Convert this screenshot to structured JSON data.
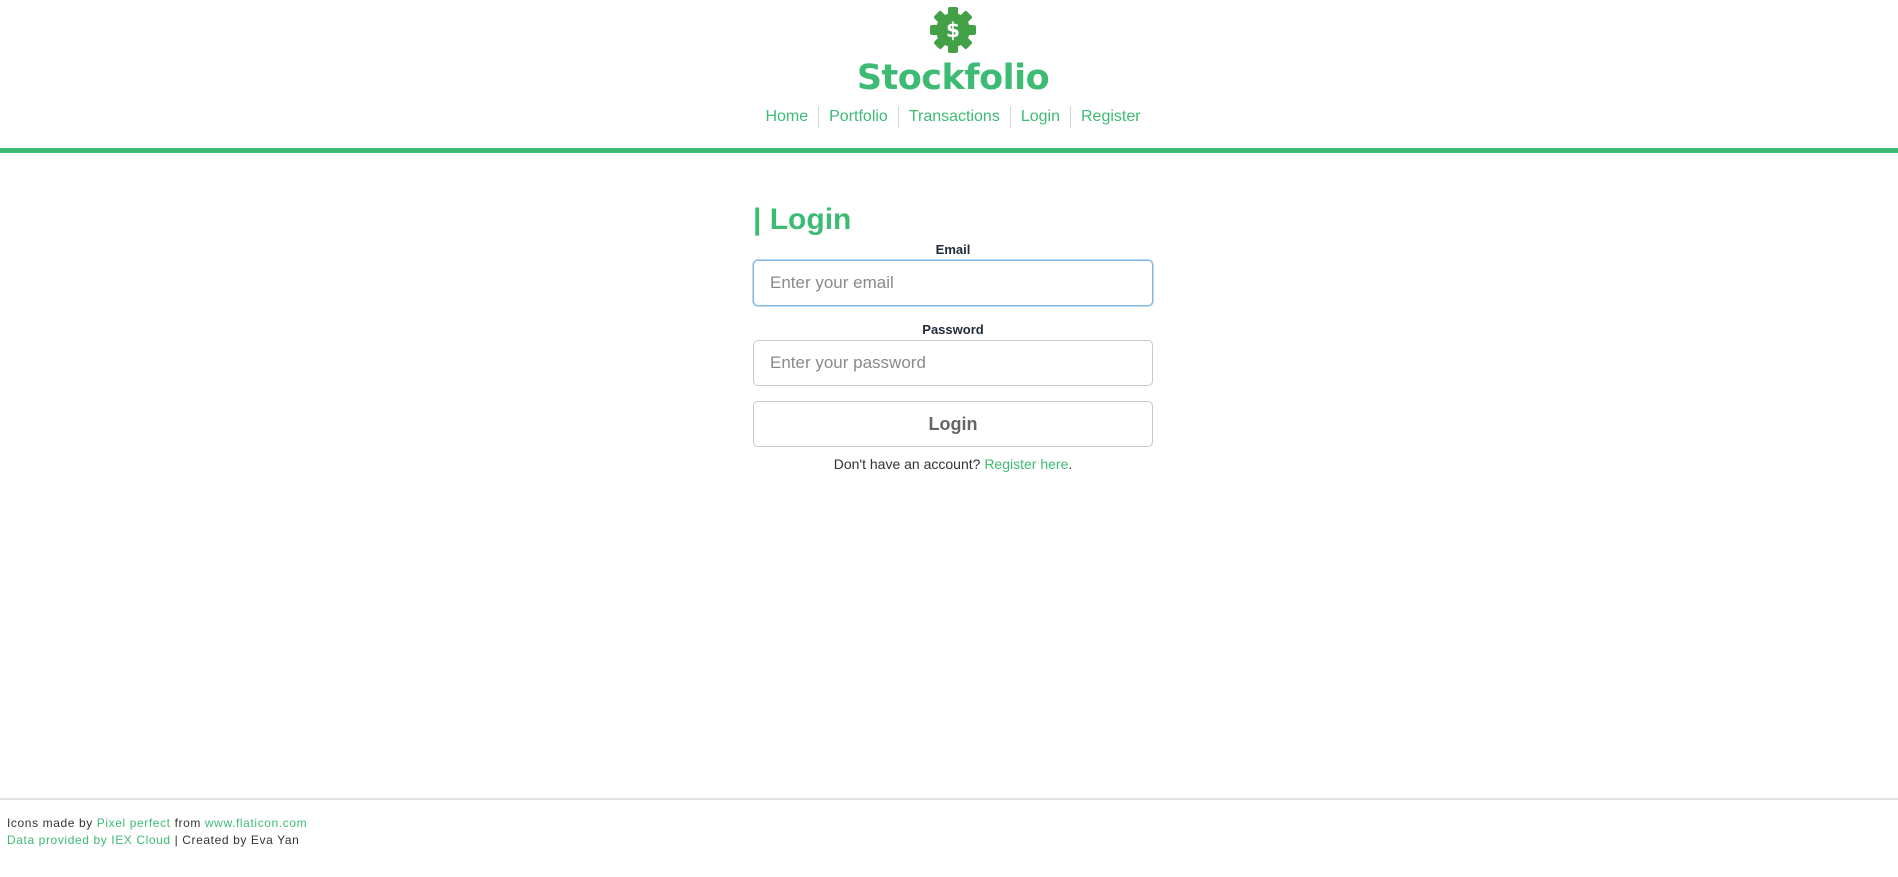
{
  "brand": {
    "name": "Stockfolio",
    "logo_icon": "gear-dollar-icon",
    "logo_glyph": "$",
    "accent_color": "#3dbb75"
  },
  "nav": {
    "items": [
      {
        "label": "Home"
      },
      {
        "label": "Portfolio"
      },
      {
        "label": "Transactions"
      },
      {
        "label": "Login"
      },
      {
        "label": "Register"
      }
    ]
  },
  "login": {
    "title": "| Login",
    "email_label": "Email",
    "email_placeholder": "Enter your email",
    "email_value": "",
    "password_label": "Password",
    "password_placeholder": "Enter your password",
    "password_value": "",
    "submit_label": "Login",
    "register_prompt": "Don't have an account?",
    "register_link": "Register here",
    "register_suffix": "."
  },
  "footer": {
    "icons_prefix": "Icons made by",
    "icons_author": "Pixel perfect",
    "icons_from": "from",
    "icons_site": "www.flaticon.com",
    "data_link": "Data provided by IEX Cloud",
    "credit": "| Created by Eva Yan"
  }
}
